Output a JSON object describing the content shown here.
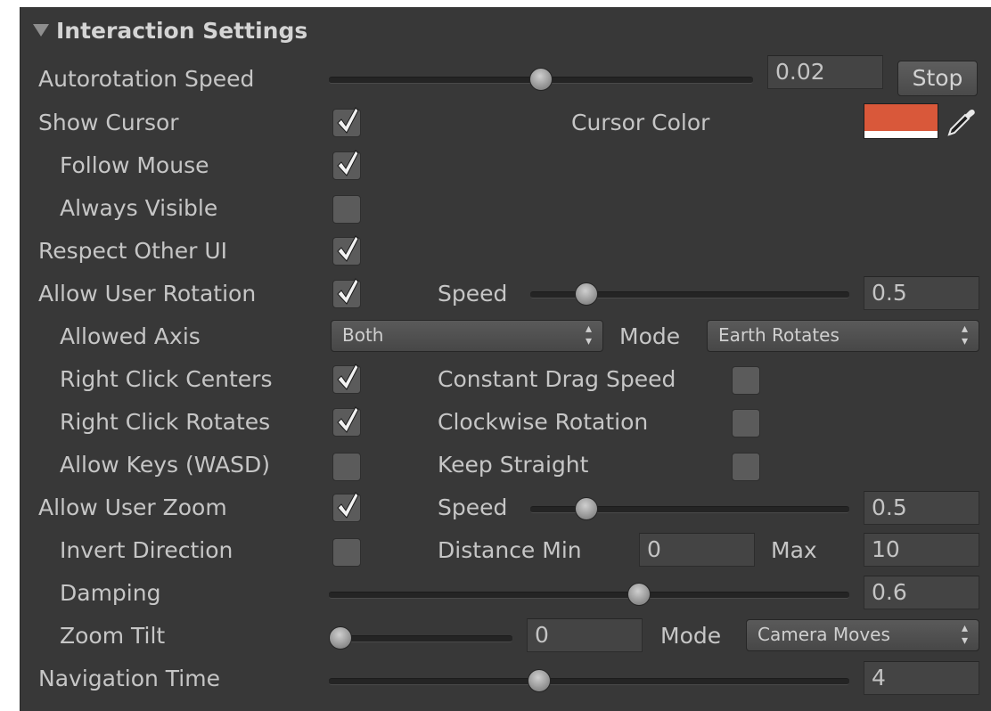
{
  "header": {
    "title": "Interaction Settings"
  },
  "autorotation": {
    "label": "Autorotation Speed",
    "slider": 0.5,
    "value": "0.02",
    "button": "Stop"
  },
  "show_cursor": {
    "label": "Show Cursor",
    "checked": true,
    "color_label": "Cursor Color",
    "color": "#d9583a"
  },
  "follow_mouse": {
    "label": "Follow Mouse",
    "checked": true
  },
  "always_visible": {
    "label": "Always Visible",
    "checked": false
  },
  "respect_ui": {
    "label": "Respect Other UI",
    "checked": true
  },
  "user_rotation": {
    "label": "Allow User Rotation",
    "checked": true,
    "speed_label": "Speed",
    "slider": 0.15,
    "value": "0.5"
  },
  "allowed_axis": {
    "label": "Allowed Axis",
    "selected": "Both",
    "mode_label": "Mode",
    "mode_selected": "Earth Rotates"
  },
  "right_click_centers": {
    "label": "Right Click Centers",
    "checked": true,
    "opt_label": "Constant Drag Speed",
    "opt_checked": false
  },
  "right_click_rotates": {
    "label": "Right Click Rotates",
    "checked": true,
    "opt_label": "Clockwise Rotation",
    "opt_checked": false
  },
  "allow_keys": {
    "label": "Allow Keys (WASD)",
    "checked": false,
    "opt_label": "Keep Straight",
    "opt_checked": false
  },
  "user_zoom": {
    "label": "Allow User Zoom",
    "checked": true,
    "speed_label": "Speed",
    "slider": 0.15,
    "value": "0.5"
  },
  "invert_direction": {
    "label": "Invert Direction",
    "checked": false,
    "min_label": "Distance Min",
    "min_value": "0",
    "max_label": "Max",
    "max_value": "10"
  },
  "damping": {
    "label": "Damping",
    "slider": 0.6,
    "value": "0.6"
  },
  "zoom_tilt": {
    "label": "Zoom Tilt",
    "slider": 0.0,
    "value": "0",
    "mode_label": "Mode",
    "mode_selected": "Camera Moves"
  },
  "navigation_time": {
    "label": "Navigation Time",
    "slider": 0.4,
    "value": "4"
  },
  "colors": {
    "panel": "#383838",
    "cursor_color": "#d9583a"
  },
  "icons": {
    "checkmark": "checkmark-icon",
    "eyedropper": "eyedropper-icon",
    "foldout": "foldout-triangle-icon"
  }
}
